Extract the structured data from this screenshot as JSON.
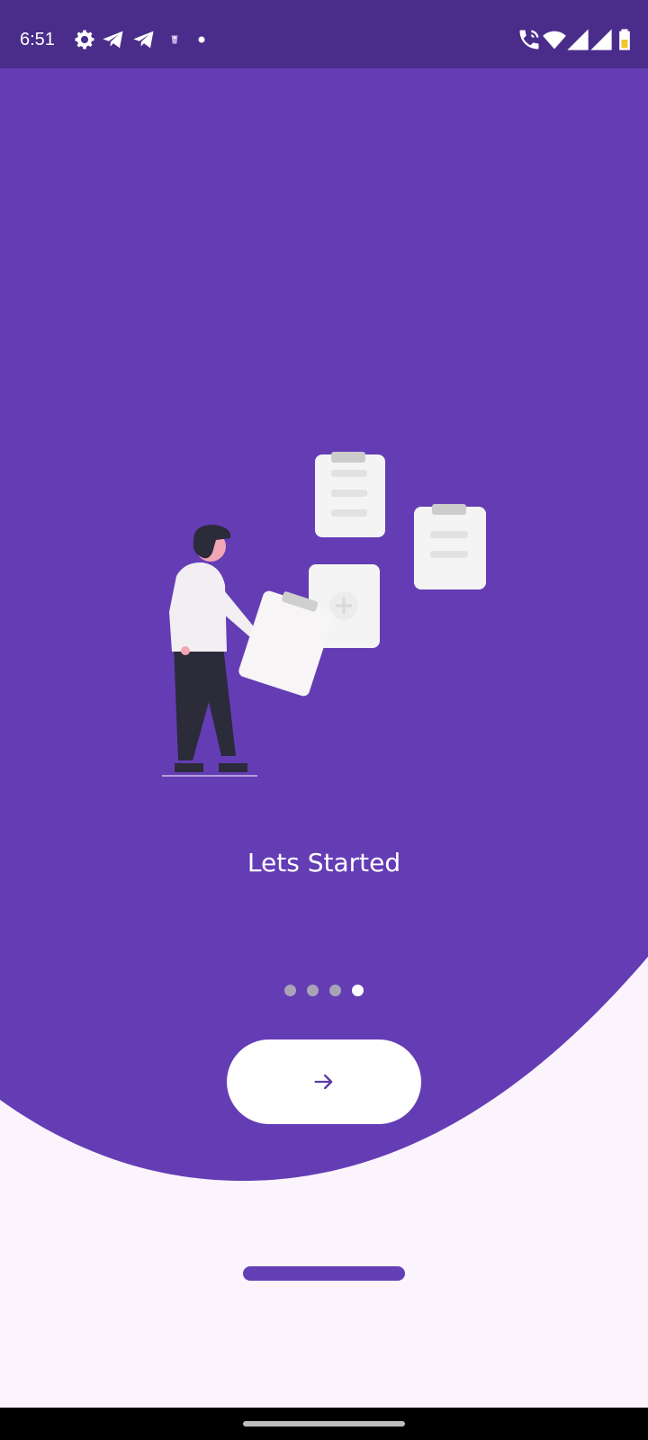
{
  "status_bar": {
    "time": "6:51",
    "left_icons": [
      "gear-icon",
      "telegram-icon",
      "telegram-icon",
      "vpn-icon",
      "dot-icon"
    ],
    "right_icons": [
      "wifi-calling-icon",
      "wifi-icon",
      "signal-icon",
      "signal-icon",
      "battery-icon"
    ]
  },
  "onboarding": {
    "title": "Lets Started",
    "page_count": 4,
    "active_page": 4,
    "next_button_icon": "arrow-right-icon"
  },
  "colors": {
    "status_bar": "#4a2d8a",
    "primary": "#643db5",
    "background": "#fcf4fc",
    "button": "#ffffff",
    "dot_inactive": "#a9a3b8",
    "dot_active": "#ffffff"
  }
}
